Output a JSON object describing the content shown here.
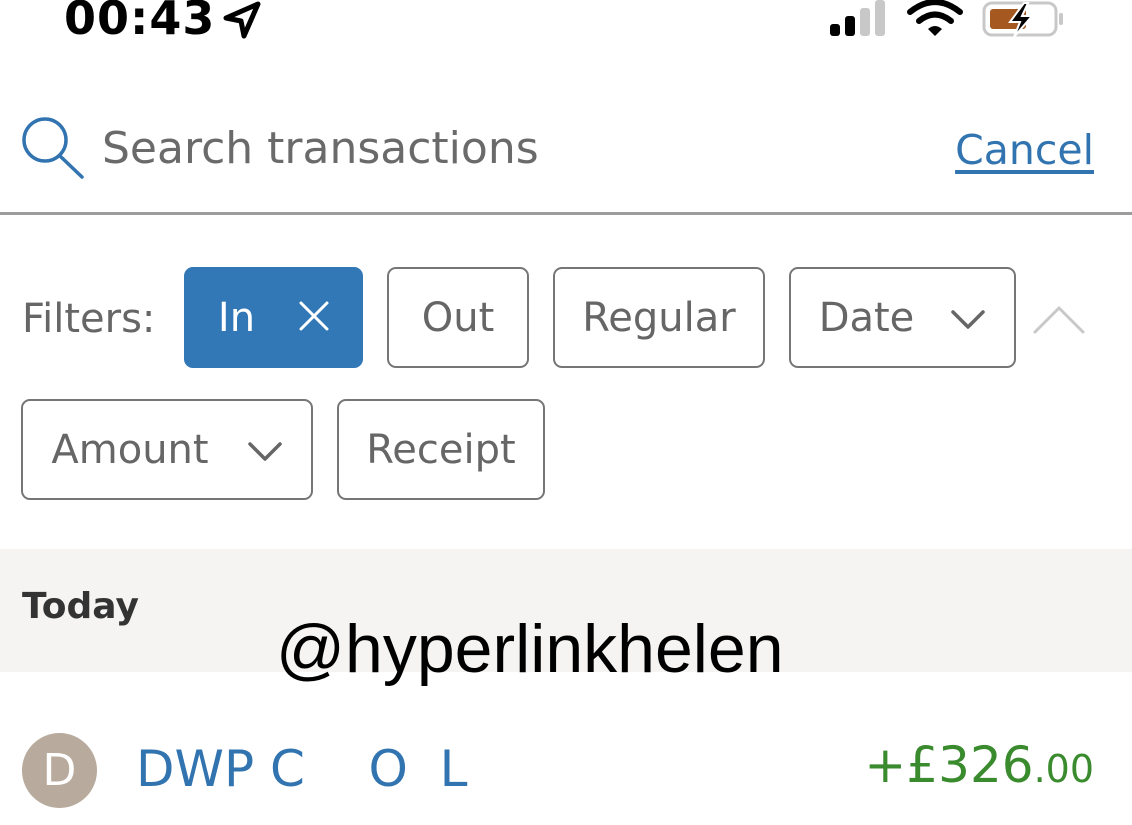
{
  "status_bar": {
    "time": "00:43",
    "icons": [
      "location-arrow-icon",
      "signal-icon",
      "wifi-icon",
      "battery-charging-icon"
    ],
    "battery_color": "#a5581f"
  },
  "search": {
    "placeholder": "Search transactions",
    "value": "",
    "cancel_label": "Cancel"
  },
  "filters": {
    "label": "Filters:",
    "chips": [
      {
        "label": "In",
        "active": true,
        "icon": "close-icon"
      },
      {
        "label": "Out",
        "active": false
      },
      {
        "label": "Regular",
        "active": false
      },
      {
        "label": "Date",
        "active": false,
        "icon": "chevron-down-icon"
      },
      {
        "label": "Amount",
        "active": false,
        "icon": "chevron-down-icon"
      },
      {
        "label": "Receipt",
        "active": false
      }
    ],
    "collapse_icon": "chevron-up-icon"
  },
  "section": {
    "title": "Today"
  },
  "watermark": "@hyperlinkhelen",
  "transactions": [
    {
      "avatar_letter": "D",
      "name": "DWP C    O  L",
      "amount_main": "+£326",
      "amount_pence": ".00"
    }
  ],
  "colors": {
    "accent": "#3278b7",
    "link": "#3274b0",
    "positive_amount": "#3a8a2e"
  }
}
